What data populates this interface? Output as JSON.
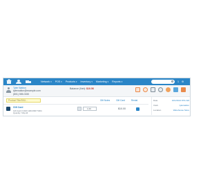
{
  "nav": {
    "menu": [
      "Network",
      "POS",
      "Products",
      "Inventory",
      "Marketing",
      "Reports"
    ],
    "right": [
      "1",
      "⚙"
    ]
  },
  "customer": {
    "name": "Tyler Walton",
    "email": "tylerwalton@example.com",
    "phone": "(801) 555-0150",
    "balance_label": "Balance (Net):",
    "balance_value": "$10.56"
  },
  "main": {
    "item_search_placeholder": "Product Title/SKU...",
    "links": [
      "Gift Notes",
      "Gift Card",
      "Rental"
    ],
    "line_item": {
      "title": "Gift Card",
      "sub": "Gift Card # 2020 1484 8067 5304",
      "sub2": "Quantity: Ship All",
      "qty": "1.00",
      "price": "$10.00"
    }
  },
  "summary": {
    "rows": [
      {
        "label": "Date",
        "value": "10/1/2021 8:51 AM"
      },
      {
        "label": "Clerk",
        "value": "tylerwalton"
      },
      {
        "label": "Location",
        "value": "Warehouse Store"
      }
    ]
  },
  "colors": {
    "accent": "#2a85c7",
    "balance": "#c0392b",
    "highlight": "#fffbd0"
  }
}
